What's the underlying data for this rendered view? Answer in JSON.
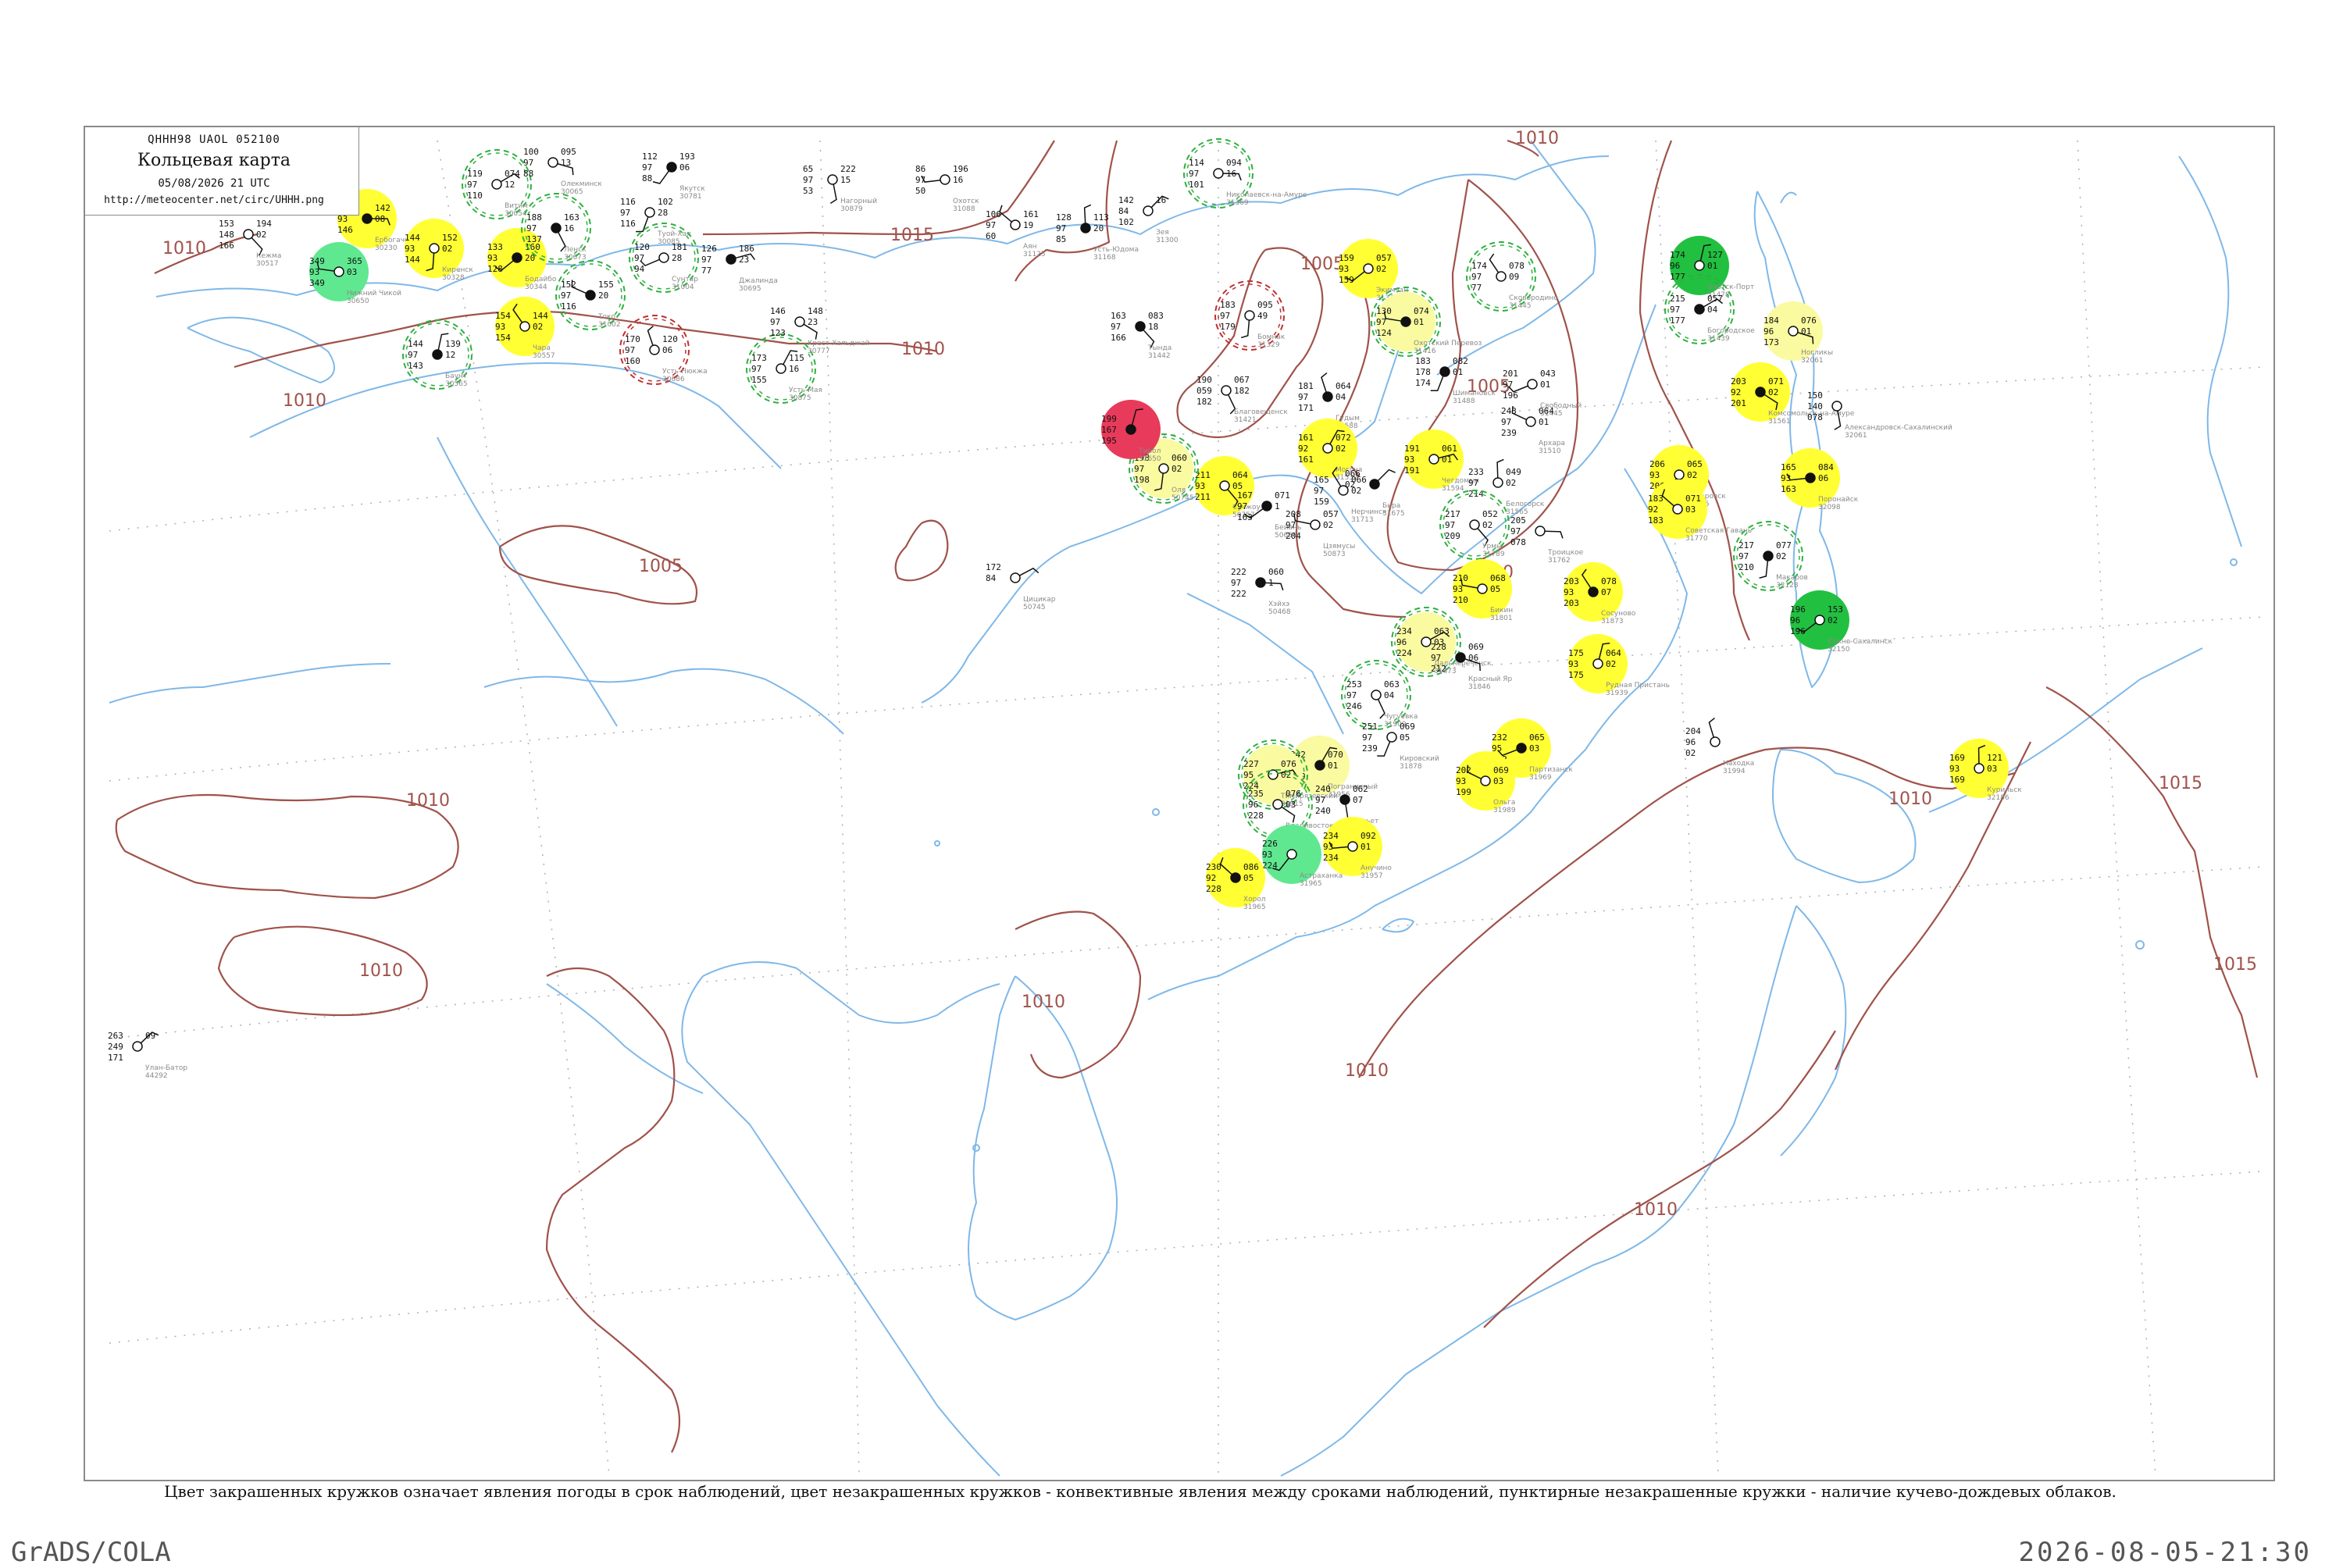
{
  "header": {
    "code": "QHHH98  UAOL  052100",
    "title": "Кольцевая карта",
    "date": "05/08/2026 21 UTC",
    "url": "http://meteocenter.net/circ/UHHH.png"
  },
  "caption": "Цвет закрашенных кружков означает явления погоды в срок наблюдений, цвет незакрашенных кружков - конвективные явления между сроками наблюдений, пунктирные незакрашенные кружки - наличие кучево-дождевых облаков.",
  "footer": {
    "left": "GrADS/COLA",
    "right": "2026-08-05-21:30"
  },
  "colors": {
    "isobar": "#a0524a",
    "coast": "#7fb8e8",
    "frame": "#8a8a8a",
    "yellow": "#ffff33",
    "pale_yellow": "#fafaa0",
    "red": "#e83a5a",
    "green": "#22c040",
    "light_green": "#60e890",
    "dashed_green": "#30b040",
    "dashed_red": "#c03030"
  },
  "isobars": [
    {
      "label": "1010"
    },
    {
      "label": "1010"
    },
    {
      "label": "1015"
    },
    {
      "label": "1010"
    },
    {
      "label": "1005"
    },
    {
      "label": "1005"
    },
    {
      "label": "1010"
    },
    {
      "label": "1005"
    },
    {
      "label": "1010"
    },
    {
      "label": "1010"
    },
    {
      "label": "1010"
    },
    {
      "label": "1010"
    },
    {
      "label": "1010"
    },
    {
      "label": "1010"
    },
    {
      "label": "1015"
    },
    {
      "label": "1015"
    },
    {
      "label": "1010"
    }
  ],
  "stations": [
    {
      "name": "Ербогачен",
      "index": "30230",
      "vals": [
        "146",
        "93",
        "146",
        "142",
        "08"
      ],
      "fill": "yellow",
      "ring": ""
    },
    {
      "name": "Кежма",
      "index": "30517",
      "vals": [
        "153",
        "148",
        "166",
        "194",
        "02"
      ],
      "fill": "",
      "ring": ""
    },
    {
      "name": "Киренск",
      "index": "30328",
      "vals": [
        "144",
        "93",
        "144",
        "152",
        "02"
      ],
      "fill": "yellow",
      "ring": ""
    },
    {
      "name": "Бодайбо",
      "index": "30344",
      "vals": [
        "133",
        "93",
        "128",
        "160",
        "20"
      ],
      "fill": "yellow",
      "ring": ""
    },
    {
      "name": "Нижний Чикой",
      "index": "30650",
      "vals": [
        "349",
        "93",
        "349",
        "365",
        "03"
      ],
      "fill": "light_green",
      "ring": ""
    },
    {
      "name": "Чара",
      "index": "30557",
      "vals": [
        "154",
        "93",
        "154",
        "144",
        "02"
      ],
      "fill": "yellow",
      "ring": ""
    },
    {
      "name": "Баунт",
      "index": "30565",
      "vals": [
        "144",
        "97",
        "143",
        "139",
        "12"
      ],
      "fill": "",
      "ring": "dashed_green"
    },
    {
      "name": "Витим",
      "index": "30054",
      "vals": [
        "119",
        "97",
        "110",
        "074",
        "12"
      ],
      "fill": "",
      "ring": "dashed_green"
    },
    {
      "name": "Олекминск",
      "index": "30065",
      "vals": [
        "100",
        "97",
        "88",
        "095",
        "13"
      ],
      "fill": "",
      "ring": ""
    },
    {
      "name": "Ленск",
      "index": "30673",
      "vals": [
        "188",
        "97",
        "137",
        "163",
        "16"
      ],
      "fill": "",
      "ring": "dashed_green"
    },
    {
      "name": "Туой-Хая",
      "index": "30085",
      "vals": [
        "116",
        "97",
        "116",
        "102",
        "28"
      ],
      "fill": "",
      "ring": ""
    },
    {
      "name": "Сунтар",
      "index": "31004",
      "vals": [
        "120",
        "97",
        "94",
        "181",
        "28"
      ],
      "fill": "",
      "ring": "dashed_green"
    },
    {
      "name": "Токо",
      "index": "31002",
      "vals": [
        "152",
        "97",
        "116",
        "155",
        "20"
      ],
      "fill": "",
      "ring": "dashed_green"
    },
    {
      "name": "Усть-Нюкжа",
      "index": "30686",
      "vals": [
        "170",
        "97",
        "160",
        "120",
        "06"
      ],
      "fill": "",
      "ring": "dashed_red"
    },
    {
      "name": "Усть-Мая",
      "index": "30875",
      "vals": [
        "173",
        "97",
        "155",
        "115",
        "16"
      ],
      "fill": "",
      "ring": "dashed_green"
    },
    {
      "name": "Джалинда",
      "index": "30695",
      "vals": [
        "126",
        "97",
        "77",
        "186",
        "23"
      ],
      "fill": "",
      "ring": ""
    },
    {
      "name": "Крест-Хальджай",
      "index": "30777",
      "vals": [
        "146",
        "97",
        "123",
        "148",
        "23"
      ],
      "fill": "",
      "ring": ""
    },
    {
      "name": "Нагорный",
      "index": "30879",
      "vals": [
        "65",
        "97",
        "53",
        "222",
        "15"
      ],
      "fill": "",
      "ring": ""
    },
    {
      "name": "Якутск",
      "index": "30781",
      "vals": [
        "112",
        "97",
        "88",
        "193",
        "06"
      ],
      "fill": "",
      "ring": ""
    },
    {
      "name": "Охотск",
      "index": "31088",
      "vals": [
        "86",
        "97",
        "50",
        "196",
        "16"
      ],
      "fill": "",
      "ring": ""
    },
    {
      "name": "Аян",
      "index": "31125",
      "vals": [
        "106",
        "97",
        "60",
        "161",
        "19"
      ],
      "fill": "",
      "ring": ""
    },
    {
      "name": "Усть-Юдома",
      "index": "31168",
      "vals": [
        "128",
        "97",
        "85",
        "113",
        "20"
      ],
      "fill": "",
      "ring": ""
    },
    {
      "name": "Зея",
      "index": "31300",
      "vals": [
        "142",
        "84",
        "102",
        "16",
        ""
      ],
      "fill": "",
      "ring": ""
    },
    {
      "name": "Николаевск-на-Амуре",
      "index": "31369",
      "vals": [
        "114",
        "97",
        "101",
        "094",
        "16"
      ],
      "fill": "",
      "ring": "dashed_green"
    },
    {
      "name": "Тында",
      "index": "31442",
      "vals": [
        "163",
        "97",
        "166",
        "083",
        "18"
      ],
      "fill": "",
      "ring": ""
    },
    {
      "name": "Бомнак",
      "index": "31329",
      "vals": [
        "183",
        "97",
        "179",
        "095",
        "49"
      ],
      "fill": "",
      "ring": "dashed_red"
    },
    {
      "name": "Экимчан",
      "index": "31348",
      "vals": [
        "159",
        "93",
        "159",
        "057",
        "02"
      ],
      "fill": "yellow",
      "ring": ""
    },
    {
      "name": "Охотский Перевоз",
      "index": "31416",
      "vals": [
        "130",
        "97",
        "124",
        "074",
        "01"
      ],
      "fill": "pale_yellow",
      "ring": "dashed_green"
    },
    {
      "name": "Сковородино",
      "index": "31445",
      "vals": [
        "174",
        "97",
        "77",
        "078",
        "09"
      ],
      "fill": "",
      "ring": "dashed_green"
    },
    {
      "name": "Охотск-Порт",
      "index": "31478",
      "vals": [
        "174",
        "96",
        "177",
        "127",
        "01"
      ],
      "fill": "green",
      "ring": ""
    },
    {
      "name": "Богородское",
      "index": "31439",
      "vals": [
        "215",
        "97",
        "177",
        "057",
        "04"
      ],
      "fill": "",
      "ring": "dashed_green"
    },
    {
      "name": "Ногликы",
      "index": "32061",
      "vals": [
        "184",
        "96",
        "173",
        "076",
        "01"
      ],
      "fill": "pale_yellow",
      "ring": ""
    },
    {
      "name": "Благовещенск",
      "index": "31421",
      "vals": [
        "190",
        "059",
        "182",
        "067",
        "182"
      ],
      "fill": "",
      "ring": ""
    },
    {
      "name": "Шимановск",
      "index": "31488",
      "vals": [
        "183",
        "178",
        "174",
        "082",
        "01"
      ],
      "fill": "",
      "ring": ""
    },
    {
      "name": "Свободный",
      "index": "31445",
      "vals": [
        "201",
        "97",
        "196",
        "043",
        "01"
      ],
      "fill": "",
      "ring": ""
    },
    {
      "name": "Архара",
      "index": "31510",
      "vals": [
        "243",
        "97",
        "239",
        "064",
        "01"
      ],
      "fill": "",
      "ring": ""
    },
    {
      "name": "Гудым",
      "index": "31588",
      "vals": [
        "181",
        "97",
        "171",
        "064",
        "04"
      ],
      "fill": "",
      "ring": ""
    },
    {
      "name": "Могоча",
      "index": "31532",
      "vals": [
        "161",
        "92",
        "161",
        "072",
        "02"
      ],
      "fill": "yellow",
      "ring": ""
    },
    {
      "name": "Чегдомын",
      "index": "31594",
      "vals": [
        "191",
        "93",
        "191",
        "061",
        "01"
      ],
      "fill": "yellow",
      "ring": ""
    },
    {
      "name": "Комсомольск-на-Амуре",
      "index": "31561",
      "vals": [
        "203",
        "92",
        "201",
        "071",
        "02"
      ],
      "fill": "yellow",
      "ring": ""
    },
    {
      "name": "Александровск-Сахалинский",
      "index": "32061",
      "vals": [
        "150",
        "140",
        "078",
        "",
        ""
      ],
      "fill": "",
      "ring": ""
    },
    {
      "name": "Хабаровск",
      "index": "31735",
      "vals": [
        "206",
        "93",
        "206",
        "065",
        "02"
      ],
      "fill": "yellow",
      "ring": ""
    },
    {
      "name": "Поронайск",
      "index": "32098",
      "vals": [
        "165",
        "93",
        "163",
        "084",
        "06"
      ],
      "fill": "yellow",
      "ring": ""
    },
    {
      "name": "Советская Гавань",
      "index": "31770",
      "vals": [
        "183",
        "92",
        "183",
        "071",
        "03"
      ],
      "fill": "yellow",
      "ring": ""
    },
    {
      "name": "Белогорск",
      "index": "31565",
      "vals": [
        "233",
        "97",
        "214",
        "049",
        "02"
      ],
      "fill": "",
      "ring": ""
    },
    {
      "name": "Бира",
      "index": "31675",
      "vals": [
        "066",
        "02",
        "",
        "",
        ""
      ],
      "fill": "",
      "ring": ""
    },
    {
      "name": "Троицкое",
      "index": "31762",
      "vals": [
        "205",
        "97",
        "078",
        "",
        ""
      ],
      "fill": "",
      "ring": ""
    },
    {
      "name": "Урмы",
      "index": "31789",
      "vals": [
        "217",
        "97",
        "209",
        "052",
        "02"
      ],
      "fill": "",
      "ring": "dashed_green"
    },
    {
      "name": "Макаров",
      "index": "32128",
      "vals": [
        "217",
        "97",
        "210",
        "077",
        "02"
      ],
      "fill": "",
      "ring": "dashed_green"
    },
    {
      "name": "Южно-Сахалинск",
      "index": "32150",
      "vals": [
        "196",
        "96",
        "196",
        "153",
        "02"
      ],
      "fill": "green",
      "ring": ""
    },
    {
      "name": "Бикин",
      "index": "31801",
      "vals": [
        "210",
        "93",
        "210",
        "068",
        "05"
      ],
      "fill": "yellow",
      "ring": ""
    },
    {
      "name": "Сосуново",
      "index": "31873",
      "vals": [
        "203",
        "93",
        "203",
        "078",
        "07"
      ],
      "fill": "yellow",
      "ring": ""
    },
    {
      "name": "Рудная Пристань",
      "index": "31939",
      "vals": [
        "175",
        "93",
        "175",
        "064",
        "02"
      ],
      "fill": "yellow",
      "ring": ""
    },
    {
      "name": "Дальнереченск",
      "index": "31873",
      "vals": [
        "234",
        "96",
        "224",
        "063",
        "03"
      ],
      "fill": "pale_yellow",
      "ring": "dashed_green"
    },
    {
      "name": "Красный Яр",
      "index": "31846",
      "vals": [
        "228",
        "97",
        "212",
        "069",
        "06"
      ],
      "fill": "",
      "ring": ""
    },
    {
      "name": "Чугуевка",
      "index": "31909",
      "vals": [
        "253",
        "97",
        "246",
        "063",
        "04"
      ],
      "fill": "",
      "ring": "dashed_green"
    },
    {
      "name": "Кировский",
      "index": "31878",
      "vals": [
        "251",
        "97",
        "239",
        "069",
        "05"
      ],
      "fill": "",
      "ring": ""
    },
    {
      "name": "Партизанск",
      "index": "31969",
      "vals": [
        "232",
        "95",
        "232",
        "065",
        "03"
      ],
      "fill": "yellow",
      "ring": ""
    },
    {
      "name": "Ольга",
      "index": "31989",
      "vals": [
        "202",
        "93",
        "199",
        "069",
        "03"
      ],
      "fill": "yellow",
      "ring": ""
    },
    {
      "name": "Находка",
      "index": "31994",
      "vals": [
        "204",
        "96",
        "02",
        "",
        ""
      ],
      "fill": "",
      "ring": ""
    },
    {
      "name": "Пограничный",
      "index": "31956",
      "vals": [
        "242",
        "95",
        "249",
        "070",
        "01"
      ],
      "fill": "pale_yellow",
      "ring": ""
    },
    {
      "name": "Тимирязевский",
      "index": "31915",
      "vals": [
        "227",
        "95",
        "224",
        "076",
        "02"
      ],
      "fill": "pale_yellow",
      "ring": "dashed_green"
    },
    {
      "name": "Владивосток",
      "index": "31960",
      "vals": [
        "235",
        "96",
        "228",
        "076",
        "03"
      ],
      "fill": "",
      "ring": "dashed_green"
    },
    {
      "name": "Посьет",
      "index": "31981",
      "vals": [
        "240",
        "97",
        "240",
        "062",
        "07"
      ],
      "fill": "",
      "ring": ""
    },
    {
      "name": "Астраханка",
      "index": "31965",
      "vals": [
        "226",
        "93",
        "224",
        "",
        ""
      ],
      "fill": "light_green",
      "ring": ""
    },
    {
      "name": "Анучино",
      "index": "31957",
      "vals": [
        "234",
        "93",
        "234",
        "092",
        "01"
      ],
      "fill": "yellow",
      "ring": ""
    },
    {
      "name": "Хорол",
      "index": "31965",
      "vals": [
        "230",
        "92",
        "228",
        "086",
        "05"
      ],
      "fill": "yellow",
      "ring": ""
    },
    {
      "name": "Курильск",
      "index": "32186",
      "vals": [
        "169",
        "93",
        "169",
        "121",
        "03"
      ],
      "fill": "yellow",
      "ring": ""
    },
    {
      "name": "Улан-Батор",
      "index": "44292",
      "vals": [
        "263",
        "249",
        "171",
        "09",
        ""
      ],
      "fill": "",
      "ring": ""
    },
    {
      "name": "Хэйхэ",
      "index": "50468",
      "vals": [
        "222",
        "97",
        "222",
        "060",
        "1"
      ],
      "fill": "",
      "ring": ""
    },
    {
      "name": "Сучжоу",
      "index": "50757",
      "vals": [
        "211",
        "93",
        "211",
        "064",
        "05"
      ],
      "fill": "yellow",
      "ring": ""
    },
    {
      "name": "Оля",
      "index": "50745",
      "vals": [
        "198",
        "97",
        "198",
        "060",
        "02"
      ],
      "fill": "pale_yellow",
      "ring": "dashed_green"
    },
    {
      "name": "Бейань",
      "index": "50656",
      "vals": [
        "167",
        "97",
        "163",
        "071",
        "1"
      ],
      "fill": "",
      "ring": ""
    },
    {
      "name": "Цзямусы",
      "index": "50873",
      "vals": [
        "208",
        "97",
        "204",
        "057",
        "02"
      ],
      "fill": "",
      "ring": ""
    },
    {
      "name": "Нерчинск",
      "index": "31713",
      "vals": [
        "165",
        "97",
        "159",
        "066",
        "02"
      ],
      "fill": "",
      "ring": ""
    },
    {
      "name": "Тирол",
      "index": "31650",
      "vals": [
        "199",
        "167",
        "195",
        "",
        ""
      ],
      "fill": "red",
      "ring": ""
    },
    {
      "name": "Цицикар",
      "index": "50745",
      "vals": [
        "172",
        "84",
        "",
        "",
        ""
      ],
      "fill": "",
      "ring": ""
    }
  ]
}
